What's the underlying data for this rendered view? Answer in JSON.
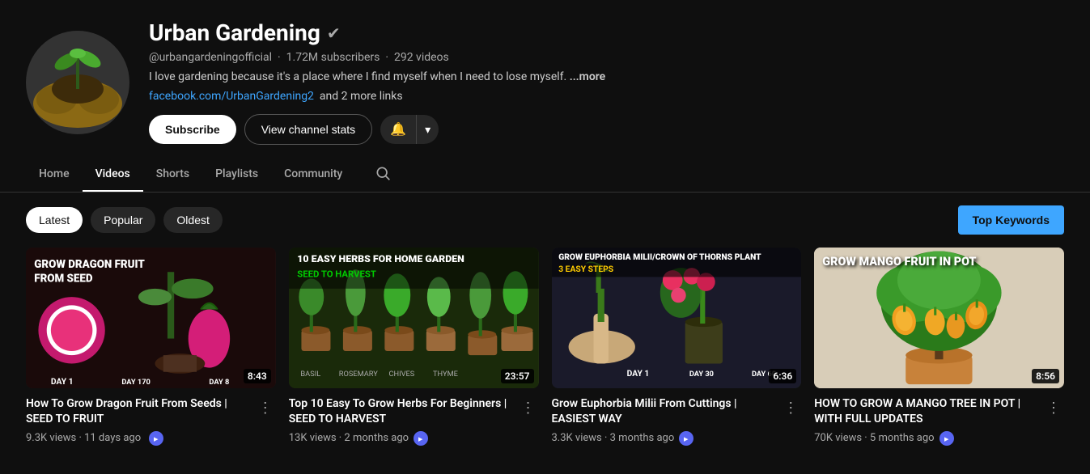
{
  "channel": {
    "name": "Urban Gardening",
    "handle": "@urbangardeningofficial",
    "subscribers": "1.72M subscribers",
    "videos": "292 videos",
    "description": "I love gardening because it's a place where I find myself when I need to lose myself.",
    "description_more": "...more",
    "link_text": "facebook.com/UrbanGardening2",
    "link_more": "and 2 more links",
    "subscribe_label": "Subscribe",
    "stats_label": "View channel stats",
    "verified_symbol": "✔"
  },
  "nav": {
    "tabs": [
      "Home",
      "Videos",
      "Shorts",
      "Playlists",
      "Community"
    ],
    "active": "Videos"
  },
  "filters": {
    "buttons": [
      "Latest",
      "Popular",
      "Oldest"
    ],
    "active": "Latest",
    "top_keywords": "Top Keywords"
  },
  "videos": [
    {
      "title": "How To Grow Dragon Fruit From Seeds | SEED TO FRUIT",
      "views": "9.3K views",
      "age": "11 days ago",
      "duration": "8:43",
      "thumb_label": "GROW DRAGON FRUIT FROM SEED",
      "thumb_type": "dragon"
    },
    {
      "title": "Top 10 Easy To Grow Herbs For Beginners | SEED TO HARVEST",
      "views": "13K views",
      "age": "2 months ago",
      "duration": "23:57",
      "thumb_label": "10 EASY HERBS FOR HOME GARDEN",
      "thumb_type": "herbs"
    },
    {
      "title": "Grow Euphorbia Milii From Cuttings | EASIEST WAY",
      "views": "3.3K views",
      "age": "3 months ago",
      "duration": "6:36",
      "thumb_label": "GROW EUPHORBIA MILII/CROWN OF THORNS PLANT",
      "thumb_type": "euphorbia"
    },
    {
      "title": "HOW TO GROW A MANGO TREE IN POT | WITH FULL UPDATES",
      "views": "70K views",
      "age": "5 months ago",
      "duration": "8:56",
      "thumb_label": "GROW MANGO FRUIT IN POT",
      "thumb_type": "mango"
    }
  ]
}
